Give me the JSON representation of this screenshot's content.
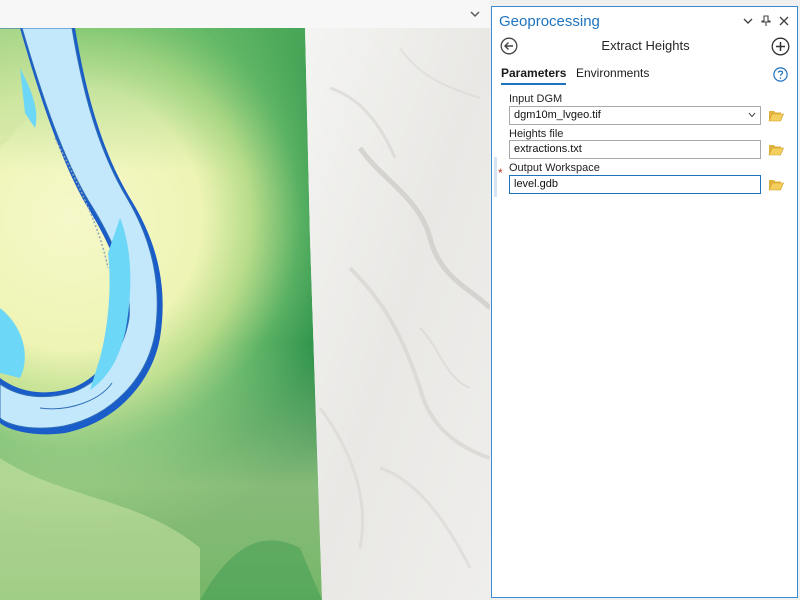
{
  "geoprocessing": {
    "title": "Geoprocessing",
    "tool_name": "Extract Heights",
    "tabs": [
      {
        "label": "Parameters",
        "active": true
      },
      {
        "label": "Environments",
        "active": false
      }
    ],
    "parameters": [
      {
        "label": "Input DGM",
        "value": "dgm10m_lvgeo.tif",
        "control": "combo",
        "required": false
      },
      {
        "label": "Heights file",
        "value": "extractions.txt",
        "control": "text",
        "required": false
      },
      {
        "label": "Output Workspace",
        "value": "level.gdb",
        "control": "text",
        "required": true
      }
    ],
    "required_marker": "*"
  },
  "icons": {
    "map_menu": "chevron-down-icon",
    "pane_options": "chevron-down-icon",
    "pin": "pin-icon",
    "close": "close-icon",
    "back": "back-arrow-icon",
    "add": "add-circle-icon",
    "help": "help-icon",
    "browse": "folder-open-icon"
  },
  "colors": {
    "accent": "#1e73be",
    "water_light": "#c4e8fb",
    "water_mid": "#6cd7f7",
    "water_deep": "#1a5cc8",
    "dem_high": "#137a3c",
    "dem_low": "#f4f7c8",
    "hillshade": "#ececea"
  }
}
